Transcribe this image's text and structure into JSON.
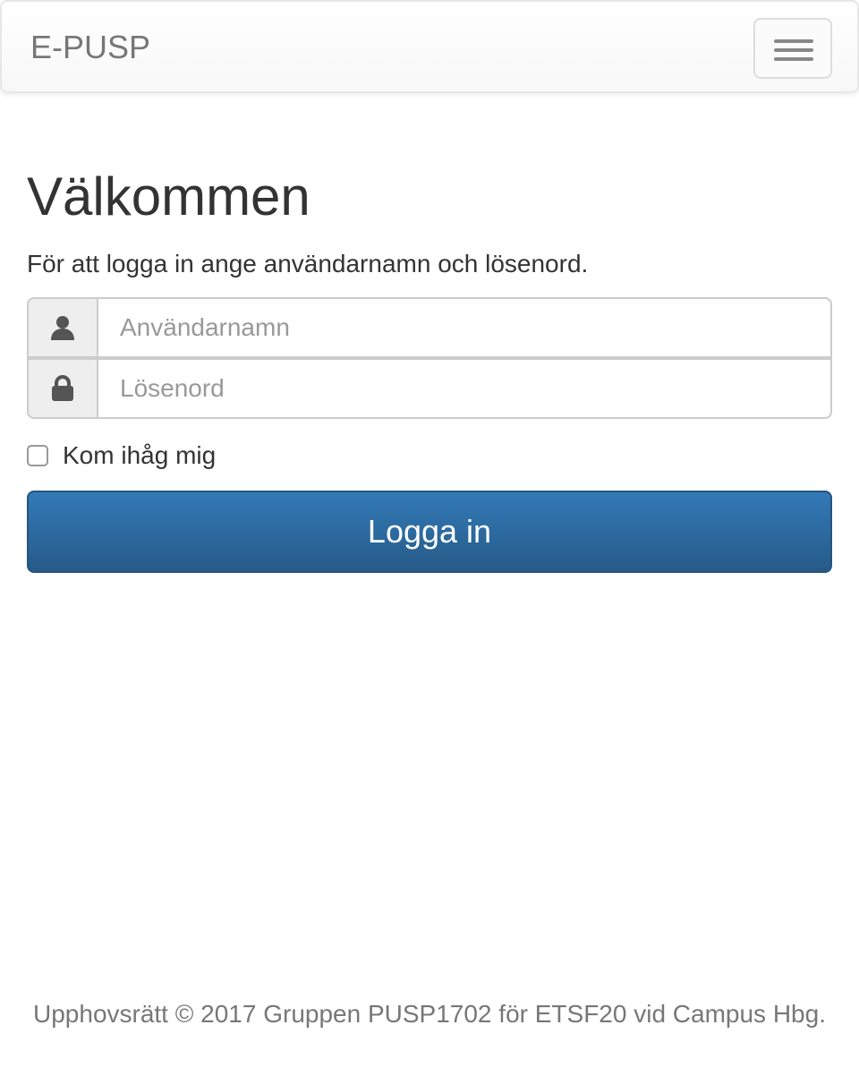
{
  "navbar": {
    "brand": "E-PUSP",
    "menu_icon": "hamburger-menu-icon"
  },
  "main": {
    "heading": "Välkommen",
    "intro": "För att logga in ange användarnamn och lösenord.",
    "username": {
      "icon": "user-icon",
      "placeholder": "Användarnamn",
      "value": ""
    },
    "password": {
      "icon": "lock-icon",
      "placeholder": "Lösenord",
      "value": ""
    },
    "remember_me": {
      "label": "Kom ihåg mig",
      "checked": false
    },
    "login_button": "Logga in"
  },
  "footer": {
    "copyright": "Upphovsrätt © 2017 Gruppen PUSP1702 för ETSF20 vid Campus Hbg."
  },
  "colors": {
    "primary": "#337ab7",
    "primary_dark": "#265a88",
    "text": "#333333",
    "muted": "#777777"
  }
}
